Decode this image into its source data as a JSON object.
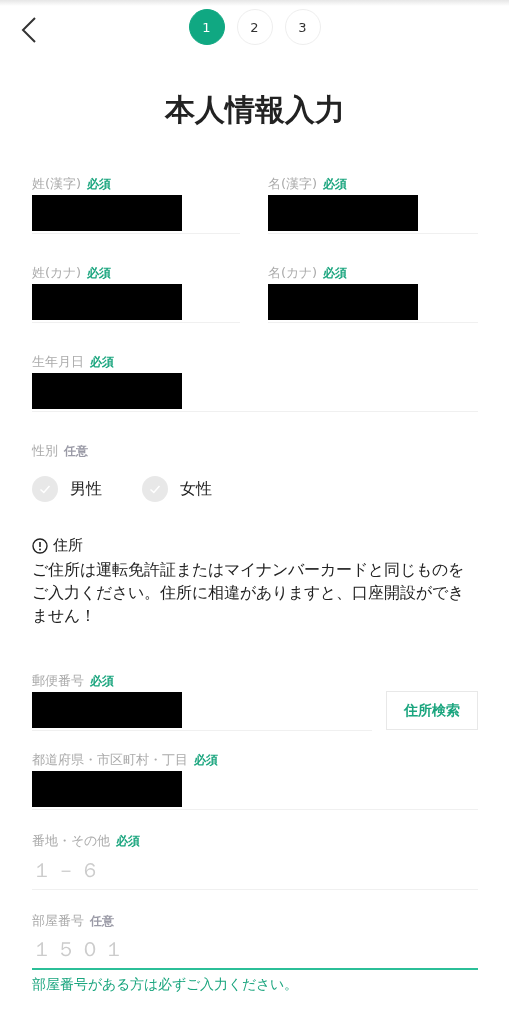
{
  "header": {
    "steps": [
      {
        "label": "1",
        "selected": true
      },
      {
        "label": "2",
        "selected": false
      },
      {
        "label": "3",
        "selected": false
      }
    ]
  },
  "title": "本人情報入力",
  "name_fields": [
    {
      "label": "姓(漢字)",
      "badge": "必須",
      "required": true,
      "redacted": true
    },
    {
      "label": "名(漢字)",
      "badge": "必須",
      "required": true,
      "redacted": true
    },
    {
      "label": "姓(カナ)",
      "badge": "必須",
      "required": true,
      "redacted": true
    },
    {
      "label": "名(カナ)",
      "badge": "必須",
      "required": true,
      "redacted": true
    }
  ],
  "birthday": {
    "label": "生年月日",
    "badge": "必須",
    "required": true,
    "redacted": true
  },
  "gender": {
    "label": "性別",
    "badge": "任意",
    "required": false,
    "options": [
      {
        "label": "男性",
        "selected": false
      },
      {
        "label": "女性",
        "selected": false
      }
    ]
  },
  "notice": {
    "title": "住所",
    "text": "ご住所は運転免許証またはマイナンバーカードと同じものをご入力ください。住所に相違がありますと、口座開設ができません！"
  },
  "postal": {
    "label": "郵便番号",
    "badge": "必須",
    "required": true,
    "redacted": true,
    "button": "住所検索"
  },
  "address_fields": [
    {
      "label": "都道府県・市区町村・丁目",
      "badge": "必須",
      "required": true,
      "redacted": true,
      "focused": false
    },
    {
      "label": "番地・その他",
      "badge": "必須",
      "required": true,
      "placeholder": "１－６",
      "focused": false
    },
    {
      "label": "部屋番号",
      "badge": "任意",
      "required": false,
      "placeholder": "１５０１",
      "focused": true,
      "hint": "部屋番号がある方は必ずご入力ください。"
    }
  ]
}
